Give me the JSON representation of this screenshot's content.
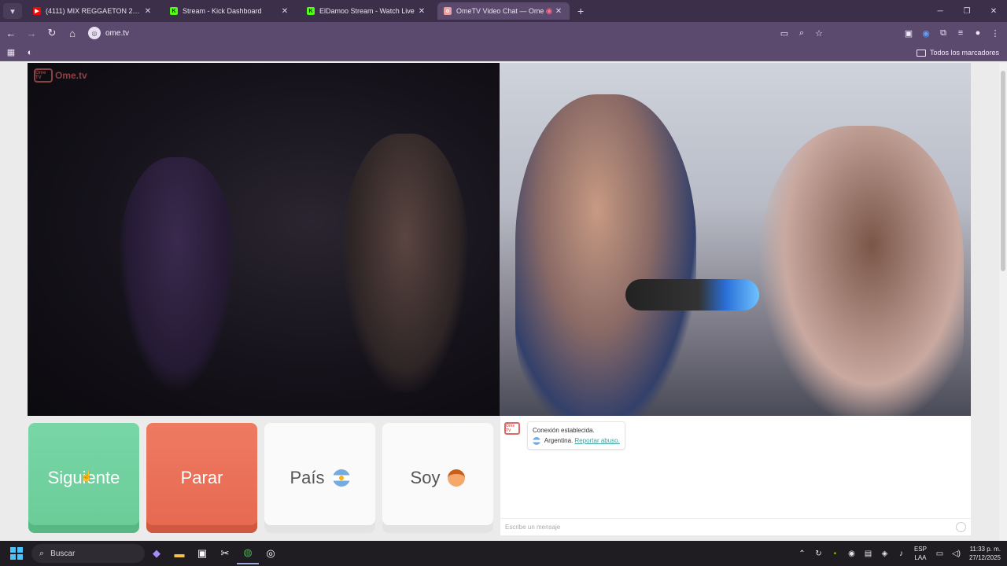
{
  "browser": {
    "tabs": [
      {
        "title": "(4111) MIX REGGAETON 2025 |",
        "favicon": "youtube-icon",
        "color": "#ff0000"
      },
      {
        "title": "Stream - Kick Dashboard",
        "favicon": "kick-icon",
        "color": "#53fc18"
      },
      {
        "title": "ElDamoo Stream - Watch Live",
        "favicon": "kick-icon",
        "color": "#53fc18"
      },
      {
        "title": "OmeTV Video Chat — Ome",
        "favicon": "ometv-icon",
        "color": "#e8a0a0"
      }
    ],
    "url": "ome.tv",
    "bookmarks_all": "Todos los marcadores"
  },
  "page": {
    "logo_text": "Ome.tv",
    "logo_box": "Ome TV",
    "buttons": {
      "next": "Siguiente",
      "stop": "Parar",
      "country": "País",
      "gender": "Soy"
    },
    "chat": {
      "status": "Conexión establecida.",
      "country": "Argentina.",
      "report": "Reportar abuso.",
      "input_placeholder": "Escribe un mensaje"
    }
  },
  "taskbar": {
    "search": "Buscar",
    "lang_top": "ESP",
    "lang_bottom": "LAA",
    "time": "11:33 p. m.",
    "date": "27/12/2025"
  },
  "colors": {
    "next": "#6acb98",
    "stop": "#e6684f",
    "browser_frame": "#5b4a6e"
  }
}
